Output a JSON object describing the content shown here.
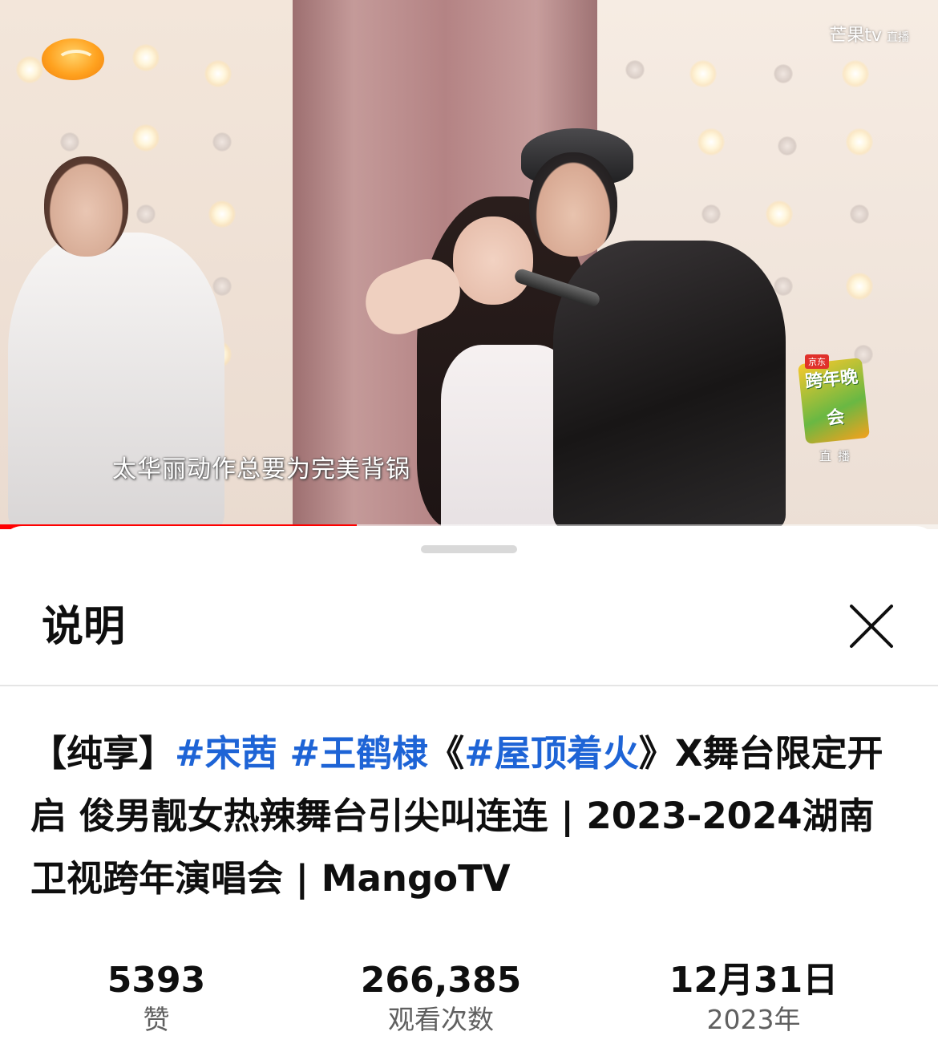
{
  "video": {
    "watermark_brand": "芒果tv",
    "watermark_live": "直播",
    "subtitle": "太华丽动作总要为完美背锅",
    "badge_sponsor": "京东",
    "badge_title": "跨年晚会",
    "badge_live": "直播",
    "progress_fraction": 0.38,
    "colors": {
      "progress": "#ff0000",
      "logo": "#ffa21f"
    }
  },
  "sheet": {
    "title": "说明",
    "close_icon": "close-icon",
    "video_title": {
      "prefix": "【纯享】",
      "tag1": "#宋茜",
      "tag2": "#王鹤棣",
      "open_bracket": "《",
      "tag3": "#屋顶着火",
      "rest": "》X舞台限定开启 俊男靓女热辣舞台引尖叫连连 | 2023-2024湖南卫视跨年演唱会 | MangoTV"
    },
    "stats": [
      {
        "value": "5393",
        "label": "赞"
      },
      {
        "value": "266,385",
        "label": "观看次数"
      },
      {
        "value": "12月31日",
        "label": "2023年"
      }
    ],
    "colors": {
      "tag": "#1e64d6",
      "title": "#0f0f0f",
      "muted": "#606060"
    }
  }
}
